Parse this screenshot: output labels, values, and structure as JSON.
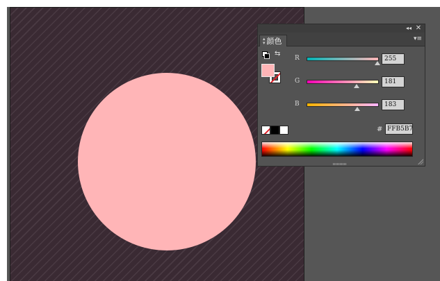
{
  "canvas": {
    "background_color": "#3a2a33",
    "stripe_color": "#4a3a43",
    "shape": {
      "type": "circle",
      "fill_color": "#ffb5b7"
    }
  },
  "panel": {
    "title": "颜色",
    "icons": {
      "collapse": "double-chevron-left-icon",
      "close": "close-icon",
      "menu": "panel-menu-icon",
      "swap": "swap-arrows-icon",
      "default": "default-fill-stroke-icon"
    },
    "glyphs": {
      "collapse": "◂◂",
      "close": "✕",
      "menu": "▾≡",
      "swap": "⇆",
      "tab_up": "▴",
      "tab_down": "▾"
    },
    "fill_color": "#ffb5b7",
    "channels": [
      {
        "label": "R",
        "value": "255",
        "fraction": 1.0,
        "gradient_start": "#00b5b7",
        "gradient_end": "#ffb5b7"
      },
      {
        "label": "G",
        "value": "181",
        "fraction": 0.71,
        "gradient_start": "#ff00b7",
        "gradient_end": "#ffffb7"
      },
      {
        "label": "B",
        "value": "183",
        "fraction": 0.717,
        "gradient_start": "#ffb500",
        "gradient_end": "#ffb5ff"
      }
    ],
    "hex_label": "#",
    "hex_value": "FFB5B7"
  }
}
